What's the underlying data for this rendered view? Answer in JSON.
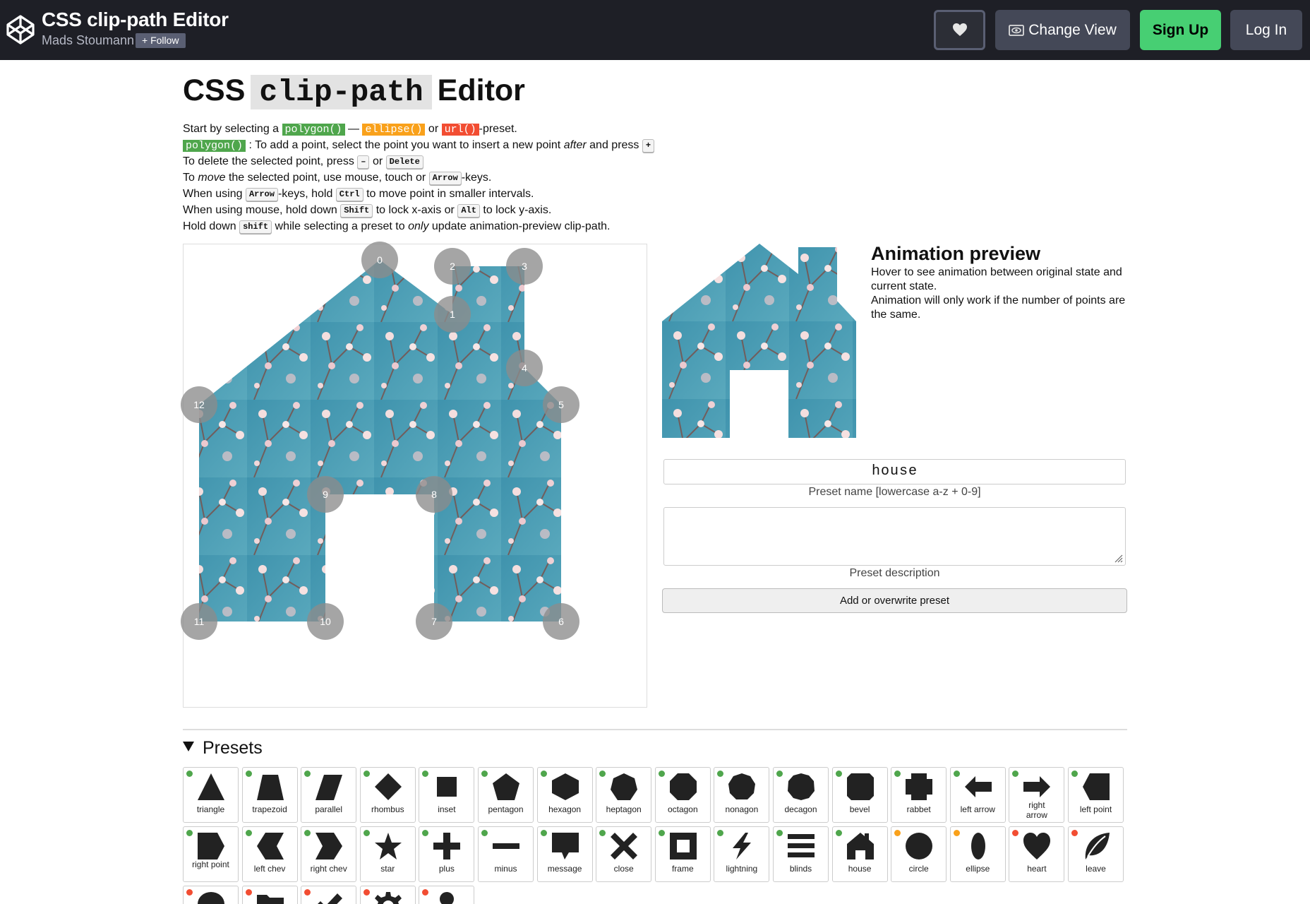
{
  "header": {
    "app_title": "CSS clip-path Editor",
    "author": "Mads Stoumann",
    "follow_label": "+ Follow",
    "change_view_label": "Change View",
    "signup_label": "Sign Up",
    "login_label": "Log In",
    "icons": {
      "logo": "codepen-logo-icon",
      "heart": "heart-icon",
      "change_view": "eye-icon"
    }
  },
  "title": {
    "before": "CSS",
    "code": "clip-path",
    "after": "Editor"
  },
  "instructions": {
    "l1": {
      "a": "Start by selecting a",
      "polygon": "polygon()",
      "dash": "—",
      "ellipse": "ellipse()",
      "or": "or",
      "url": "url()",
      "end": "-preset."
    },
    "l2": {
      "polygon": "polygon()",
      "a": ": To add a point, select the point you want to insert a new point",
      "after": "after",
      "b": "and press",
      "key": "+"
    },
    "l3": {
      "a": "To delete the selected point, press",
      "key1": "–",
      "or": "or",
      "key2": "Delete"
    },
    "l4": {
      "a": "To",
      "move": "move",
      "b": "the selected point, use mouse, touch or",
      "key": "Arrow",
      "c": "-keys."
    },
    "l5": {
      "a": "When using",
      "key1": "Arrow",
      "b": "-keys, hold",
      "key2": "Ctrl",
      "c": "to move point in smaller intervals."
    },
    "l6": {
      "a": "When using mouse, hold down",
      "key1": "Shift",
      "b": "to lock x-axis or",
      "key2": "Alt",
      "c": "to lock y-axis."
    },
    "l7": {
      "a": "Hold down",
      "key": "shift",
      "b": "while selecting a preset to",
      "only": "only",
      "c": "update animation-preview clip-path."
    }
  },
  "editor": {
    "points": [
      "0",
      "1",
      "2",
      "3",
      "4",
      "5",
      "6",
      "7",
      "8",
      "9",
      "10",
      "11",
      "12"
    ]
  },
  "preview": {
    "title": "Animation preview",
    "line1": "Hover to see animation between original state and current state.",
    "line2": "Animation will only work if the number of points are the same."
  },
  "form": {
    "preset_name_value": "house",
    "preset_name_label": "Preset name [lowercase a-z + 0-9]",
    "preset_description_value": "",
    "preset_description_label": "Preset description",
    "add_button_label": "Add or overwrite preset"
  },
  "presets": {
    "heading": "Presets",
    "colors": {
      "polygon": "#4fa64c",
      "ellipse": "#f9a11b",
      "url": "#f24d32"
    },
    "items": [
      {
        "label": "triangle",
        "icon": "triangle-icon",
        "type": "polygon"
      },
      {
        "label": "trapezoid",
        "icon": "trapezoid-icon",
        "type": "polygon"
      },
      {
        "label": "parallel",
        "icon": "parallelogram-icon",
        "type": "polygon"
      },
      {
        "label": "rhombus",
        "icon": "rhombus-icon",
        "type": "polygon"
      },
      {
        "label": "inset",
        "icon": "inset-icon",
        "type": "polygon"
      },
      {
        "label": "pentagon",
        "icon": "pentagon-icon",
        "type": "polygon"
      },
      {
        "label": "hexagon",
        "icon": "hexagon-icon",
        "type": "polygon"
      },
      {
        "label": "heptagon",
        "icon": "heptagon-icon",
        "type": "polygon"
      },
      {
        "label": "octagon",
        "icon": "octagon-icon",
        "type": "polygon"
      },
      {
        "label": "nonagon",
        "icon": "nonagon-icon",
        "type": "polygon"
      },
      {
        "label": "decagon",
        "icon": "decagon-icon",
        "type": "polygon"
      },
      {
        "label": "bevel",
        "icon": "bevel-icon",
        "type": "polygon"
      },
      {
        "label": "rabbet",
        "icon": "rabbet-icon",
        "type": "polygon"
      },
      {
        "label": "left arrow",
        "icon": "left-arrow-icon",
        "type": "polygon"
      },
      {
        "label": "right arrow",
        "icon": "right-arrow-icon",
        "type": "polygon"
      },
      {
        "label": "left point",
        "icon": "left-point-icon",
        "type": "polygon"
      },
      {
        "label": "right point",
        "icon": "right-point-icon",
        "type": "polygon"
      },
      {
        "label": "left chev",
        "icon": "left-chevron-icon",
        "type": "polygon"
      },
      {
        "label": "right chev",
        "icon": "right-chevron-icon",
        "type": "polygon"
      },
      {
        "label": "star",
        "icon": "star-icon",
        "type": "polygon"
      },
      {
        "label": "plus",
        "icon": "plus-icon",
        "type": "polygon"
      },
      {
        "label": "minus",
        "icon": "minus-icon",
        "type": "polygon"
      },
      {
        "label": "message",
        "icon": "message-icon",
        "type": "polygon"
      },
      {
        "label": "close",
        "icon": "close-icon",
        "type": "polygon"
      },
      {
        "label": "frame",
        "icon": "frame-icon",
        "type": "polygon"
      },
      {
        "label": "lightning",
        "icon": "lightning-icon",
        "type": "polygon"
      },
      {
        "label": "blinds",
        "icon": "blinds-icon",
        "type": "polygon"
      },
      {
        "label": "house",
        "icon": "house-icon",
        "type": "polygon"
      },
      {
        "label": "circle",
        "icon": "circle-icon",
        "type": "ellipse"
      },
      {
        "label": "ellipse",
        "icon": "ellipse-icon",
        "type": "ellipse"
      },
      {
        "label": "heart",
        "icon": "heart-icon",
        "type": "url"
      },
      {
        "label": "leave",
        "icon": "leaf-icon",
        "type": "url"
      },
      {
        "label": "",
        "icon": "speech-bubble-icon",
        "type": "url"
      },
      {
        "label": "",
        "icon": "folder-icon",
        "type": "url"
      },
      {
        "label": "",
        "icon": "checkmark-icon",
        "type": "url"
      },
      {
        "label": "",
        "icon": "gear-icon",
        "type": "url"
      },
      {
        "label": "",
        "icon": "user-icon",
        "type": "url"
      }
    ]
  }
}
